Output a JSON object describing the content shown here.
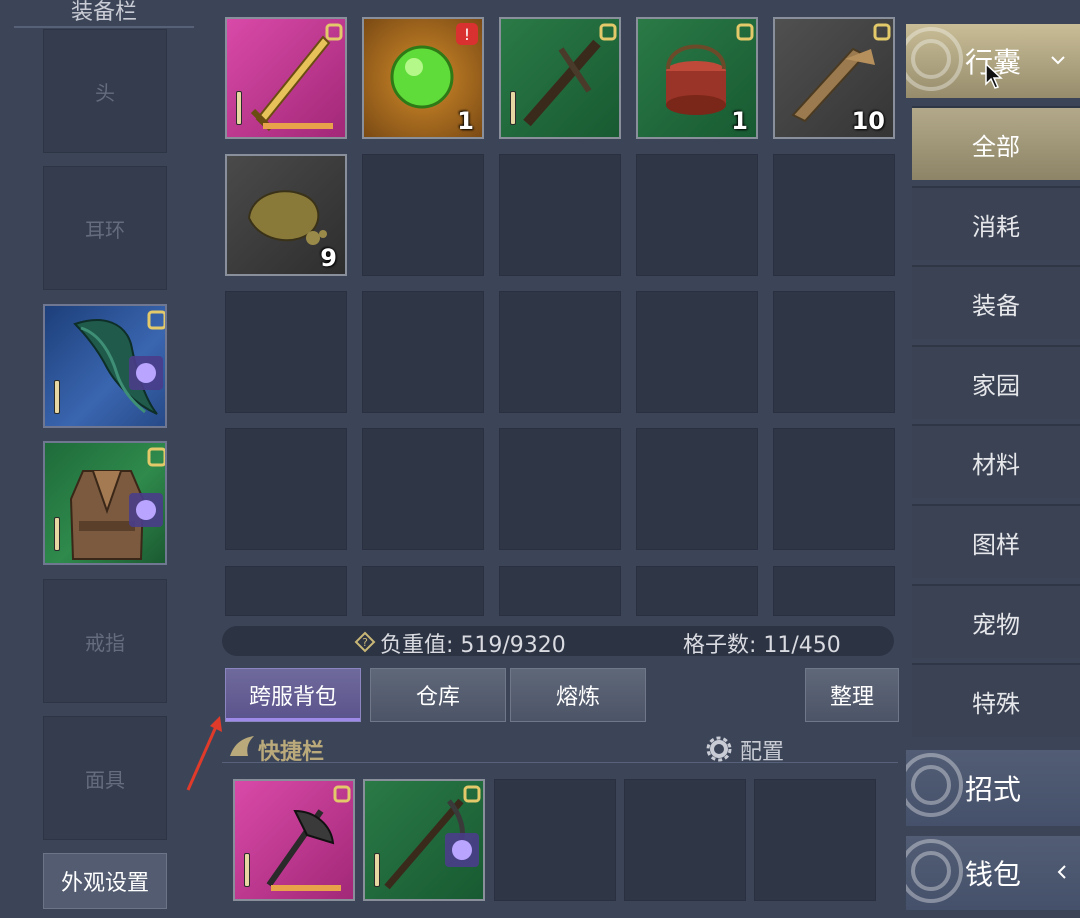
{
  "equipment": {
    "title": "装备栏",
    "slots": [
      "头",
      "耳环",
      "",
      "",
      "戒指",
      "面具"
    ],
    "appearance_button": "外观设置"
  },
  "inventory": {
    "items": [
      {
        "name": "golden-sword",
        "qty": "",
        "bg": "#c0358f"
      },
      {
        "name": "green-orb",
        "qty": "1",
        "bg": "#8a5418"
      },
      {
        "name": "crossbow",
        "qty": "",
        "bg": "#1f6a39"
      },
      {
        "name": "food-box",
        "qty": "1",
        "bg": "#1f6a39"
      },
      {
        "name": "wood-planks",
        "qty": "10",
        "bg": "#4a4a4a"
      },
      {
        "name": "ore",
        "qty": "9",
        "bg": "#3e3e3e"
      }
    ],
    "weight_label": "负重值: 519/9320",
    "slots_label": "格子数: 11/450"
  },
  "buttons": {
    "cross_server_bag": "跨服背包",
    "warehouse": "仓库",
    "smelt": "熔炼",
    "sort": "整理"
  },
  "shortcut": {
    "title": "快捷栏",
    "config": "配置"
  },
  "tabs": {
    "bag": "行囊",
    "categories": [
      "全部",
      "消耗",
      "装备",
      "家园",
      "材料",
      "图样",
      "宠物",
      "特殊"
    ],
    "skills": "招式",
    "wallet": "钱包"
  },
  "colors": {
    "rare_pink": "#c0358f",
    "uncommon_green": "#1f6a39",
    "gold_accent": "#b3a98a",
    "active_purple": "#6f6a9c"
  }
}
